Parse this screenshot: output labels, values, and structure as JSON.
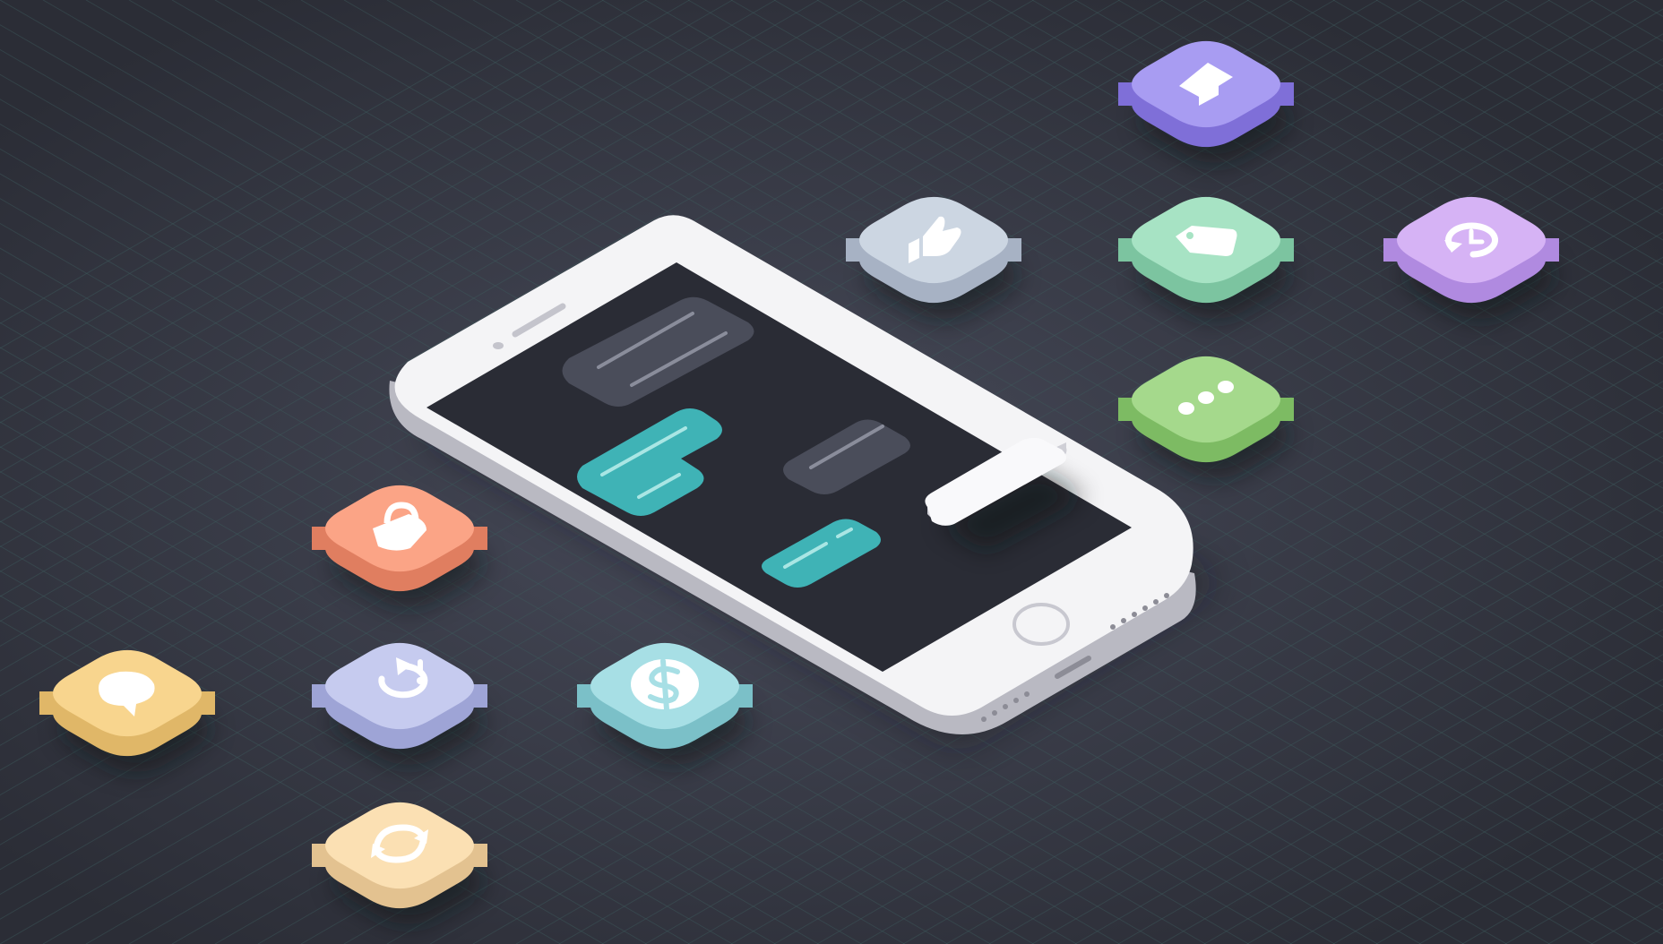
{
  "palette": {
    "background": "#2b2d36",
    "background_glow": "#474a59",
    "grid_line": "#3f5a5e",
    "phone_body": "#f4f4f6",
    "phone_shadow": "#a7a7b0",
    "screen": "#2a2c35",
    "bubble_incoming": "#4a4d5a",
    "bubble_outgoing": "#3fb3b6",
    "bubble_line": "#8a8d9b",
    "bubble_line_outgoing": "#a9e6e4",
    "icon_glyph": "#ffffff"
  },
  "icons": [
    {
      "id": "home",
      "name": "home-tile",
      "glyph": "home-icon",
      "top": "#a89cf2",
      "side": "#7f6fd8"
    },
    {
      "id": "like",
      "name": "like-tile",
      "glyph": "thumbs-up-icon",
      "top": "#ccd6e2",
      "side": "#a7b2c4"
    },
    {
      "id": "tag",
      "name": "tag-tile",
      "glyph": "price-tag-icon",
      "top": "#a7e3c4",
      "side": "#7cc4a0"
    },
    {
      "id": "history",
      "name": "history-tile",
      "glyph": "history-icon",
      "top": "#d6b3f5",
      "side": "#b08ae0"
    },
    {
      "id": "more",
      "name": "more-tile",
      "glyph": "ellipsis-icon",
      "top": "#a5d98c",
      "side": "#7dbb63"
    },
    {
      "id": "lock",
      "name": "lock-tile",
      "glyph": "lock-icon",
      "top": "#fba486",
      "side": "#e07e60"
    },
    {
      "id": "chat",
      "name": "chat-tile",
      "glyph": "speech-bubble-icon",
      "top": "#f8d58e",
      "side": "#e0b768"
    },
    {
      "id": "alert",
      "name": "refresh-alert-tile",
      "glyph": "refresh-alert-icon",
      "top": "#c6cbef",
      "side": "#9ea4d6"
    },
    {
      "id": "money",
      "name": "money-tile",
      "glyph": "dollar-icon",
      "top": "#a7dfe5",
      "side": "#7bc0c8"
    },
    {
      "id": "sync",
      "name": "sync-tile",
      "glyph": "sync-icon",
      "top": "#fbe0b3",
      "side": "#e3c290"
    }
  ]
}
